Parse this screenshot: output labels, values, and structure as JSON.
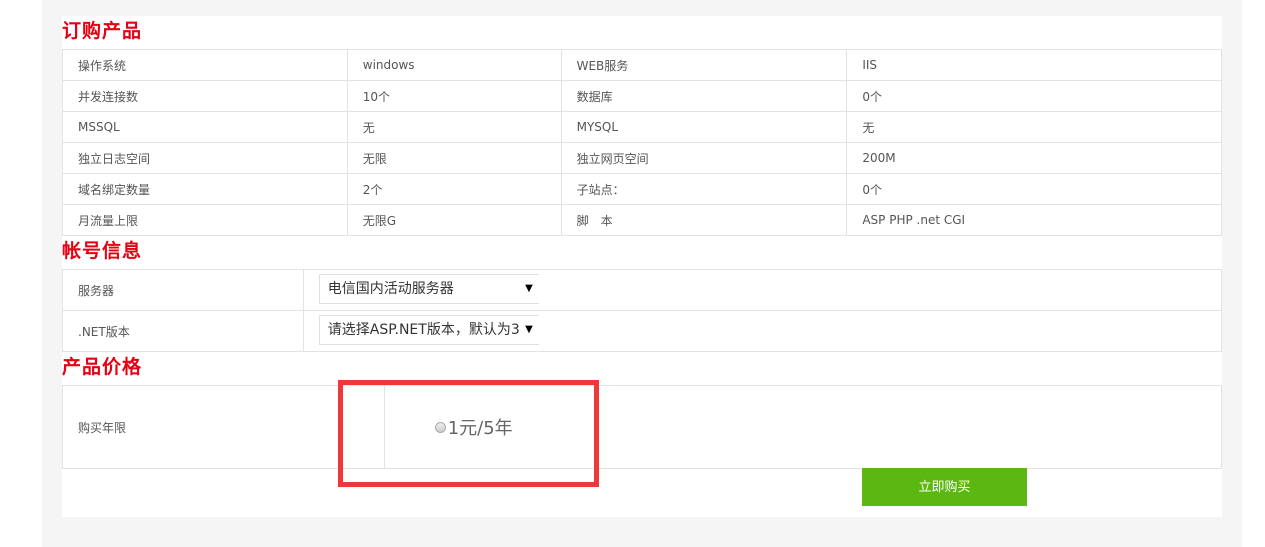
{
  "sections": {
    "order_title": "订购产品",
    "account_title": "帐号信息",
    "price_title": "产品价格"
  },
  "spec_rows": [
    [
      "操作系统",
      "windows",
      "WEB服务",
      "IIS"
    ],
    [
      "并发连接数",
      "10个",
      "数据库",
      "0个"
    ],
    [
      "MSSQL",
      "无",
      "MYSQL",
      "无"
    ],
    [
      "独立日志空间",
      "无限",
      "独立网页空间",
      "200M"
    ],
    [
      "域名绑定数量",
      "2个",
      "子站点：",
      "0个"
    ],
    [
      "月流量上限",
      "无限G",
      "脚　本",
      "ASP PHP .net CGI"
    ]
  ],
  "account": {
    "server_label": "服务器",
    "server_value": "电信国内活动服务器",
    "net_label": ".NET版本",
    "net_value": "请选择ASP.NET版本，默认为3."
  },
  "price": {
    "years_label": "购买年限",
    "option": "1元/5年"
  },
  "buy_button": "立即购买",
  "colors": {
    "title_red": "#e60012",
    "button_green": "#5cb811",
    "highlight_red": "#f0383a"
  }
}
